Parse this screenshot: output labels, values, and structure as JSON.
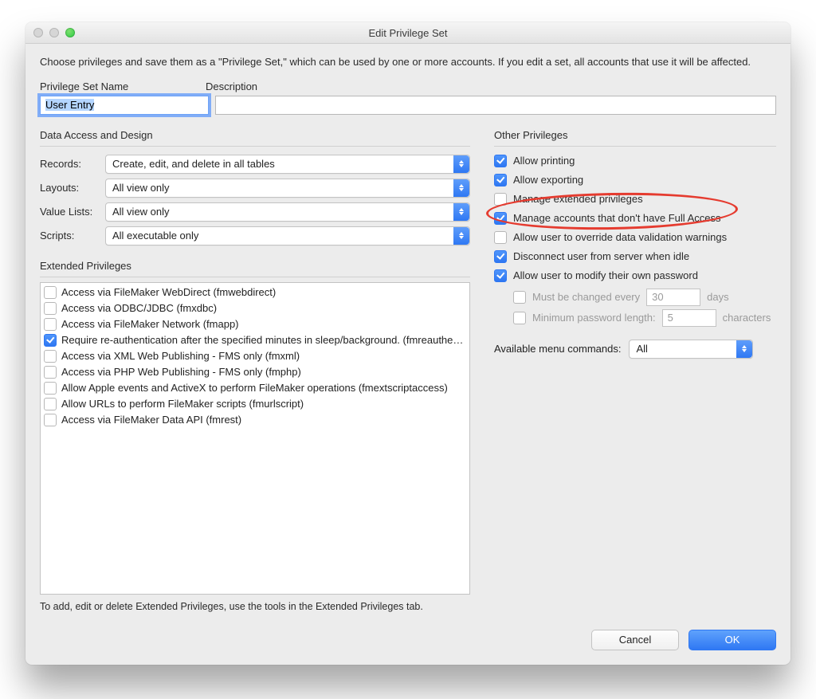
{
  "window": {
    "title": "Edit Privilege Set"
  },
  "intro": "Choose privileges and save them as a \"Privilege Set,\" which can be used by one or more accounts. If you edit a set, all accounts that use it will be affected.",
  "labels": {
    "privilege_set_name": "Privilege Set Name",
    "description": "Description",
    "data_access": "Data Access and Design",
    "records": "Records:",
    "layouts": "Layouts:",
    "value_lists": "Value Lists:",
    "scripts": "Scripts:",
    "extended": "Extended Privileges",
    "other": "Other Privileges",
    "available_menu": "Available menu commands:",
    "hint": "To add, edit or delete Extended Privileges, use the tools in the Extended Privileges tab.",
    "days": "days",
    "characters": "characters"
  },
  "fields": {
    "privilege_set_name": "User Entry",
    "description": ""
  },
  "selects": {
    "records": "Create, edit, and delete in all tables",
    "layouts": "All view only",
    "value_lists": "All view only",
    "scripts": "All executable only",
    "available_menu": "All"
  },
  "extended_privileges": [
    {
      "label": "Access via FileMaker WebDirect (fmwebdirect)",
      "checked": false
    },
    {
      "label": "Access via ODBC/JDBC (fmxdbc)",
      "checked": false
    },
    {
      "label": "Access via FileMaker Network (fmapp)",
      "checked": false
    },
    {
      "label": "Require re-authentication after the specified minutes in sleep/background. (fmreauthe…",
      "checked": true
    },
    {
      "label": "Access via XML Web Publishing - FMS only (fmxml)",
      "checked": false
    },
    {
      "label": "Access via PHP Web Publishing - FMS only (fmphp)",
      "checked": false
    },
    {
      "label": "Allow Apple events and ActiveX to perform FileMaker operations (fmextscriptaccess)",
      "checked": false
    },
    {
      "label": "Allow URLs to perform FileMaker scripts (fmurlscript)",
      "checked": false
    },
    {
      "label": "Access via FileMaker Data API (fmrest)",
      "checked": false
    }
  ],
  "other_privileges": {
    "allow_printing": {
      "label": "Allow printing",
      "checked": true
    },
    "allow_exporting": {
      "label": "Allow exporting",
      "checked": true
    },
    "manage_extended": {
      "label": "Manage extended privileges",
      "checked": false
    },
    "manage_accounts": {
      "label": "Manage accounts that don't have Full Access",
      "checked": true
    },
    "allow_override": {
      "label": "Allow user to override data validation warnings",
      "checked": false
    },
    "disconnect_idle": {
      "label": "Disconnect user from server when idle",
      "checked": true
    },
    "modify_password": {
      "label": "Allow user to modify their own password",
      "checked": true
    },
    "must_change": {
      "label": "Must be changed every",
      "checked": false,
      "value": "30"
    },
    "min_length": {
      "label": "Minimum password length:",
      "checked": false,
      "value": "5"
    }
  },
  "buttons": {
    "cancel": "Cancel",
    "ok": "OK"
  }
}
